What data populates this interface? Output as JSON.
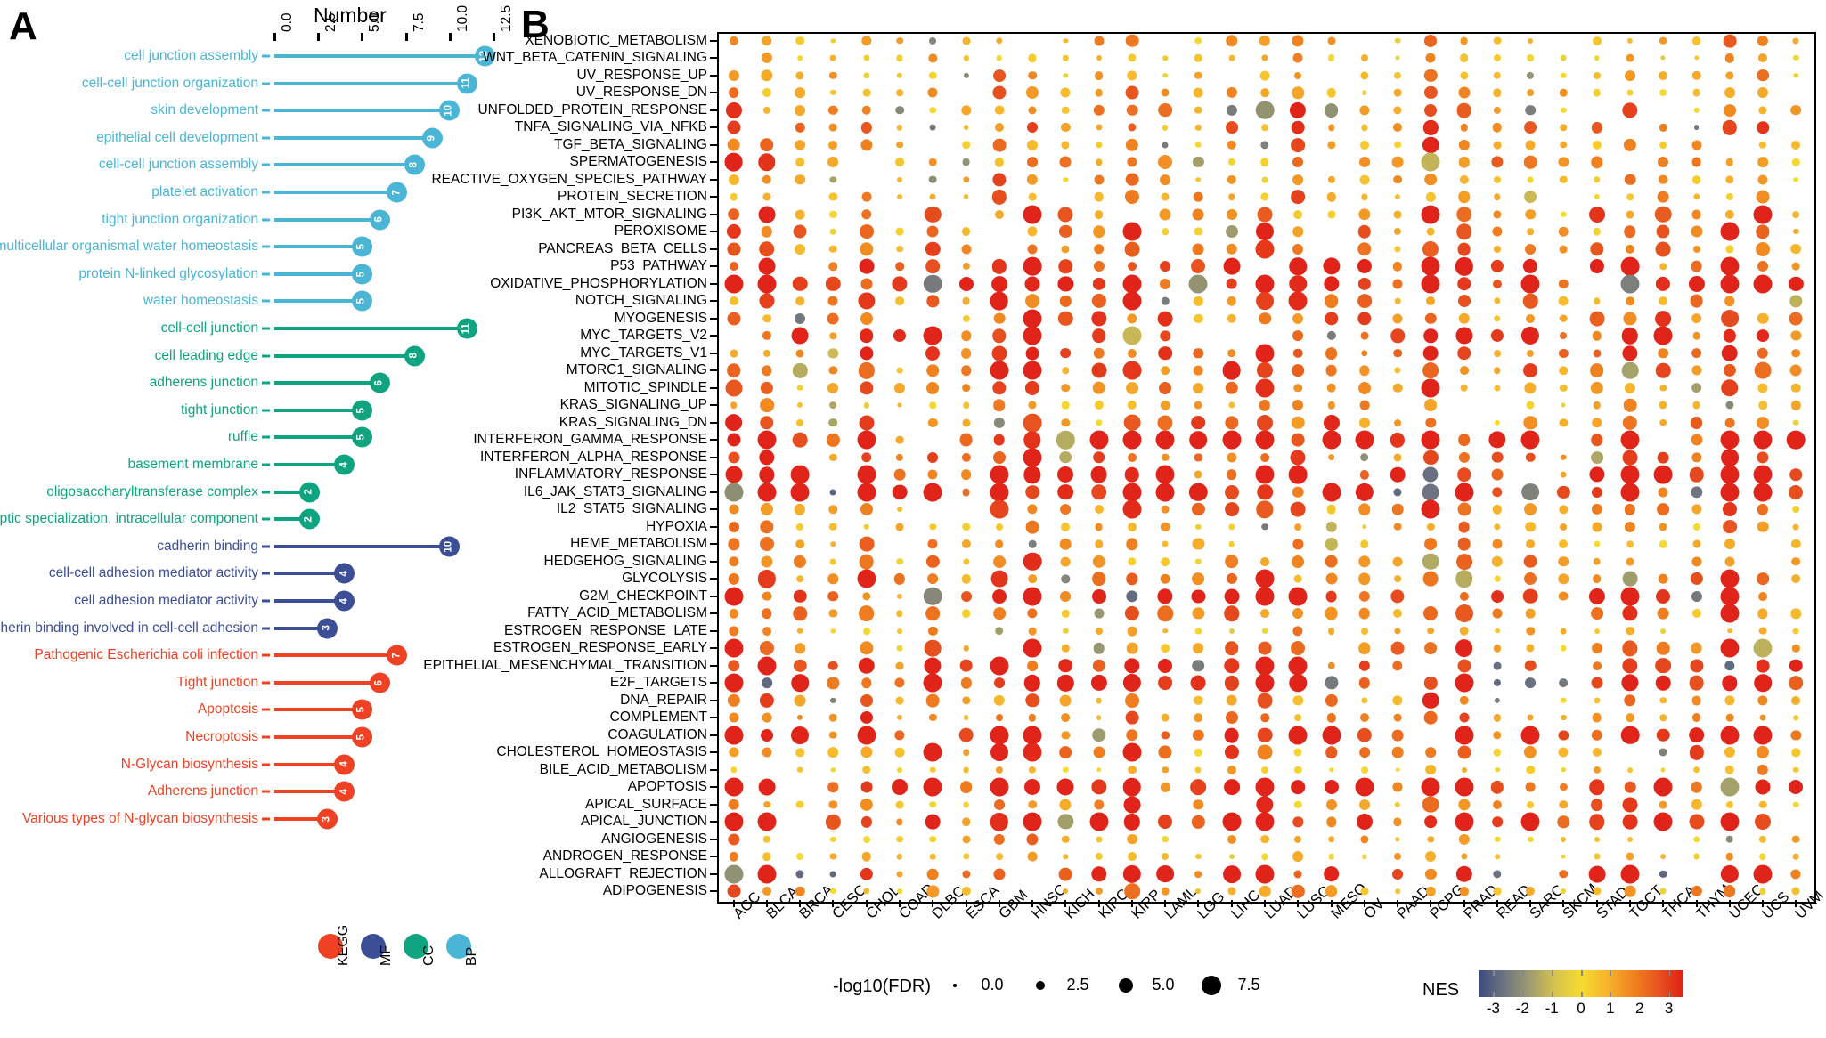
{
  "panels": {
    "a_letter": "A",
    "b_letter": "B"
  },
  "panelA": {
    "axis_title": "Number",
    "x_ticks": [
      "0.0",
      "2.5",
      "5.0",
      "7.5",
      "10.0",
      "12.5"
    ],
    "x_tick_values": [
      0,
      2.5,
      5,
      7.5,
      10,
      12.5
    ],
    "colors": {
      "BP": "#4BB5D5",
      "CC": "#0FA47F",
      "MF": "#3B4E96",
      "KEGG": "#EF4123"
    },
    "legend": [
      {
        "label": "KEGG",
        "color": "#EF4123"
      },
      {
        "label": "MF",
        "color": "#3B4E96"
      },
      {
        "label": "CC",
        "color": "#0FA47F"
      },
      {
        "label": "BP",
        "color": "#4BB5D5"
      }
    ],
    "items": [
      {
        "label": "cell junction assembly",
        "value": 12,
        "group": "BP"
      },
      {
        "label": "cell-cell junction organization",
        "value": 11,
        "group": "BP"
      },
      {
        "label": "skin development",
        "value": 10,
        "group": "BP"
      },
      {
        "label": "epithelial cell development",
        "value": 9,
        "group": "BP"
      },
      {
        "label": "cell-cell junction assembly",
        "value": 8,
        "group": "BP"
      },
      {
        "label": "platelet activation",
        "value": 7,
        "group": "BP"
      },
      {
        "label": "tight junction organization",
        "value": 6,
        "group": "BP"
      },
      {
        "label": "multicellular organismal water homeostasis",
        "value": 5,
        "group": "BP"
      },
      {
        "label": "protein N-linked glycosylation",
        "value": 5,
        "group": "BP"
      },
      {
        "label": "water homeostasis",
        "value": 5,
        "group": "BP"
      },
      {
        "label": "cell-cell junction",
        "value": 11,
        "group": "CC"
      },
      {
        "label": "cell leading edge",
        "value": 8,
        "group": "CC"
      },
      {
        "label": "adherens junction",
        "value": 6,
        "group": "CC"
      },
      {
        "label": "tight junction",
        "value": 5,
        "group": "CC"
      },
      {
        "label": "ruffle",
        "value": 5,
        "group": "CC"
      },
      {
        "label": "basement membrane",
        "value": 4,
        "group": "CC"
      },
      {
        "label": "oligosaccharyltransferase complex",
        "value": 2,
        "group": "CC"
      },
      {
        "label": "postsynaptic specialization, intracellular component",
        "value": 2,
        "group": "CC"
      },
      {
        "label": "cadherin binding",
        "value": 10,
        "group": "MF"
      },
      {
        "label": "cell-cell adhesion mediator activity",
        "value": 4,
        "group": "MF"
      },
      {
        "label": "cell adhesion mediator activity",
        "value": 4,
        "group": "MF"
      },
      {
        "label": "cadherin binding involved in cell-cell adhesion",
        "value": 3,
        "group": "MF"
      },
      {
        "label": "Pathogenic Escherichia coli infection",
        "value": 7,
        "group": "KEGG"
      },
      {
        "label": "Tight junction",
        "value": 6,
        "group": "KEGG"
      },
      {
        "label": "Apoptosis",
        "value": 5,
        "group": "KEGG"
      },
      {
        "label": "Necroptosis",
        "value": 5,
        "group": "KEGG"
      },
      {
        "label": "N-Glycan biosynthesis",
        "value": 4,
        "group": "KEGG"
      },
      {
        "label": "Adherens junction",
        "value": 4,
        "group": "KEGG"
      },
      {
        "label": "Various types of N-glycan biosynthesis",
        "value": 3,
        "group": "KEGG"
      }
    ]
  },
  "panelB": {
    "size_legend": {
      "title": "-log10(FDR)",
      "values": [
        "0.0",
        "2.5",
        "5.0",
        "7.5"
      ],
      "numeric": [
        0,
        2.5,
        5,
        7.5
      ]
    },
    "color_legend": {
      "title": "NES",
      "ticks": [
        "-3",
        "-2",
        "-1",
        "0",
        "1",
        "2",
        "3"
      ],
      "range": [
        -3.5,
        3.5
      ]
    },
    "cancer_types": [
      "ACC",
      "BLCA",
      "BRCA",
      "CESC",
      "CHOL",
      "COAD",
      "DLBC",
      "ESCA",
      "GBM",
      "HNSC",
      "KICH",
      "KIRC",
      "KIRP",
      "LAML",
      "LGG",
      "LIHC",
      "LUAD",
      "LUSC",
      "MESO",
      "OV",
      "PAAD",
      "PCPG",
      "PRAD",
      "READ",
      "SARC",
      "SKCM",
      "STAD",
      "TGCT",
      "THCA",
      "THYM",
      "UCEC",
      "UCS",
      "UVM"
    ],
    "pathways": [
      "XENOBIOTIC_METABOLISM",
      "WNT_BETA_CATENIN_SIGNALING",
      "UV_RESPONSE_UP",
      "UV_RESPONSE_DN",
      "UNFOLDED_PROTEIN_RESPONSE",
      "TNFA_SIGNALING_VIA_NFKB",
      "TGF_BETA_SIGNALING",
      "SPERMATOGENESIS",
      "REACTIVE_OXYGEN_SPECIES_PATHWAY",
      "PROTEIN_SECRETION",
      "PI3K_AKT_MTOR_SIGNALING",
      "PEROXISOME",
      "PANCREAS_BETA_CELLS",
      "P53_PATHWAY",
      "OXIDATIVE_PHOSPHORYLATION",
      "NOTCH_SIGNALING",
      "MYOGENESIS",
      "MYC_TARGETS_V2",
      "MYC_TARGETS_V1",
      "MTORC1_SIGNALING",
      "MITOTIC_SPINDLE",
      "KRAS_SIGNALING_UP",
      "KRAS_SIGNALING_DN",
      "INTERFERON_GAMMA_RESPONSE",
      "INTERFERON_ALPHA_RESPONSE",
      "INFLAMMATORY_RESPONSE",
      "IL6_JAK_STAT3_SIGNALING",
      "IL2_STAT5_SIGNALING",
      "HYPOXIA",
      "HEME_METABOLISM",
      "HEDGEHOG_SIGNALING",
      "GLYCOLYSIS",
      "G2M_CHECKPOINT",
      "FATTY_ACID_METABOLISM",
      "ESTROGEN_RESPONSE_LATE",
      "ESTROGEN_RESPONSE_EARLY",
      "EPITHELIAL_MESENCHYMAL_TRANSITION",
      "E2F_TARGETS",
      "DNA_REPAIR",
      "COMPLEMENT",
      "COAGULATION",
      "CHOLESTEROL_HOMEOSTASIS",
      "BILE_ACID_METABOLISM",
      "APOPTOSIS",
      "APICAL_SURFACE",
      "APICAL_JUNCTION",
      "ANGIOGENESIS",
      "ANDROGEN_RESPONSE",
      "ALLOGRAFT_REJECTION",
      "ADIPOGENESIS"
    ]
  },
  "chart_data": [
    {
      "type": "bar",
      "title": "Number",
      "xlabel": "Number",
      "ylabel": "",
      "xlim": [
        0,
        12.5
      ],
      "grid": false,
      "categories": [
        "cell junction assembly",
        "cell-cell junction organization",
        "skin development",
        "epithelial cell development",
        "cell-cell junction assembly",
        "platelet activation",
        "tight junction organization",
        "multicellular organismal water homeostasis",
        "protein N-linked glycosylation",
        "water homeostasis",
        "cell-cell junction",
        "cell leading edge",
        "adherens junction",
        "tight junction",
        "ruffle",
        "basement membrane",
        "oligosaccharyltransferase complex",
        "postsynaptic specialization, intracellular component",
        "cadherin binding",
        "cell-cell adhesion mediator activity",
        "cell adhesion mediator activity",
        "cadherin binding involved in cell-cell adhesion",
        "Pathogenic Escherichia coli infection",
        "Tight junction",
        "Apoptosis",
        "Necroptosis",
        "N-Glycan biosynthesis",
        "Adherens junction",
        "Various types of N-glycan biosynthesis"
      ],
      "values": [
        12,
        11,
        10,
        9,
        8,
        7,
        6,
        5,
        5,
        5,
        11,
        8,
        6,
        5,
        5,
        4,
        2,
        2,
        10,
        4,
        4,
        3,
        7,
        6,
        5,
        5,
        4,
        4,
        3
      ],
      "legend": [
        "KEGG",
        "MF",
        "CC",
        "BP"
      ],
      "legend_position": "bottom"
    },
    {
      "type": "heatmap",
      "subtype": "dotplot",
      "title": "",
      "xlabel": "",
      "ylabel": "",
      "x": [
        "ACC",
        "BLCA",
        "BRCA",
        "CESC",
        "CHOL",
        "COAD",
        "DLBC",
        "ESCA",
        "GBM",
        "HNSC",
        "KICH",
        "KIRC",
        "KIRP",
        "LAML",
        "LGG",
        "LIHC",
        "LUAD",
        "LUSC",
        "MESO",
        "OV",
        "PAAD",
        "PCPG",
        "PRAD",
        "READ",
        "SARC",
        "SKCM",
        "STAD",
        "TGCT",
        "THCA",
        "THYM",
        "UCEC",
        "UCS",
        "UVM"
      ],
      "y": [
        "XENOBIOTIC_METABOLISM",
        "WNT_BETA_CATENIN_SIGNALING",
        "UV_RESPONSE_UP",
        "UV_RESPONSE_DN",
        "UNFOLDED_PROTEIN_RESPONSE",
        "TNFA_SIGNALING_VIA_NFKB",
        "TGF_BETA_SIGNALING",
        "SPERMATOGENESIS",
        "REACTIVE_OXYGEN_SPECIES_PATHWAY",
        "PROTEIN_SECRETION",
        "PI3K_AKT_MTOR_SIGNALING",
        "PEROXISOME",
        "PANCREAS_BETA_CELLS",
        "P53_PATHWAY",
        "OXIDATIVE_PHOSPHORYLATION",
        "NOTCH_SIGNALING",
        "MYOGENESIS",
        "MYC_TARGETS_V2",
        "MYC_TARGETS_V1",
        "MTORC1_SIGNALING",
        "MITOTIC_SPINDLE",
        "KRAS_SIGNALING_UP",
        "KRAS_SIGNALING_DN",
        "INTERFERON_GAMMA_RESPONSE",
        "INTERFERON_ALPHA_RESPONSE",
        "INFLAMMATORY_RESPONSE",
        "IL6_JAK_STAT3_SIGNALING",
        "IL2_STAT5_SIGNALING",
        "HYPOXIA",
        "HEME_METABOLISM",
        "HEDGEHOG_SIGNALING",
        "GLYCOLYSIS",
        "G2M_CHECKPOINT",
        "FATTY_ACID_METABOLISM",
        "ESTROGEN_RESPONSE_LATE",
        "ESTROGEN_RESPONSE_EARLY",
        "EPITHELIAL_MESENCHYMAL_TRANSITION",
        "E2F_TARGETS",
        "DNA_REPAIR",
        "COMPLEMENT",
        "COAGULATION",
        "CHOLESTEROL_HOMEOSTASIS",
        "BILE_ACID_METABOLISM",
        "APOPTOSIS",
        "APICAL_SURFACE",
        "APICAL_JUNCTION",
        "ANGIOGENESIS",
        "ANDROGEN_RESPONSE",
        "ALLOGRAFT_REJECTION",
        "ADIPOGENESIS"
      ],
      "size_encoding": "-log10(FDR)",
      "size_range": [
        0,
        7.5
      ],
      "color_encoding": "NES",
      "color_range": [
        -3.5,
        3.5
      ],
      "colormap": [
        "#3B4A7E",
        "#6E7480",
        "#9E9C6E",
        "#D7C24E",
        "#F5DB2E",
        "#F7B42C",
        "#F08520",
        "#E8541F",
        "#E01E18"
      ],
      "legend_position": "bottom"
    }
  ]
}
